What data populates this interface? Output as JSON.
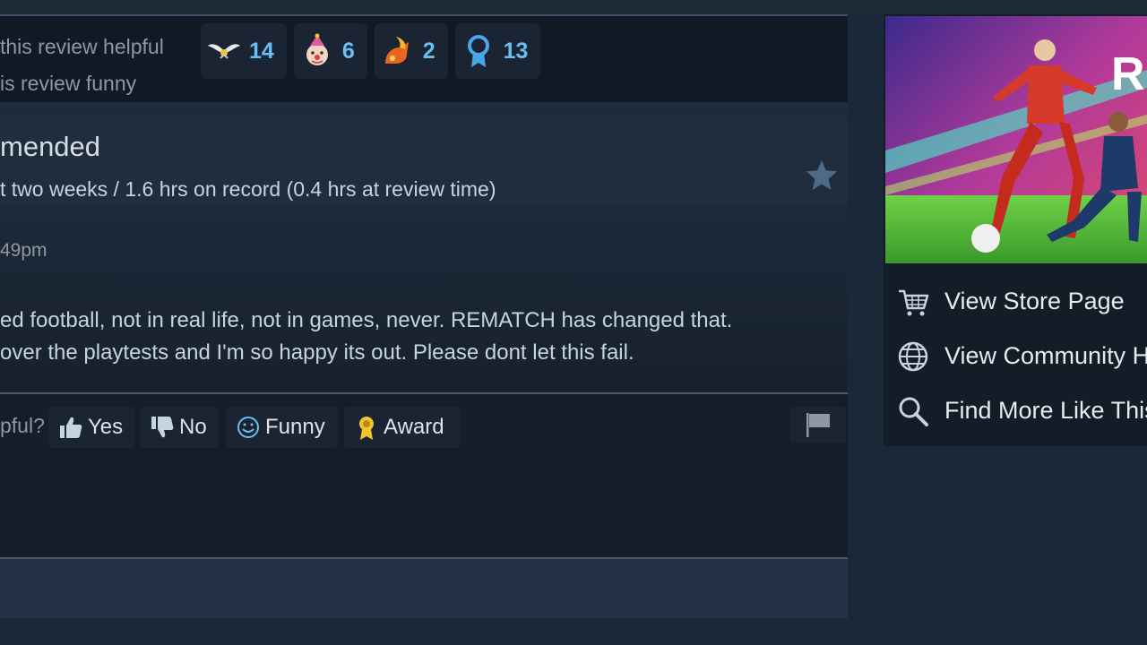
{
  "helpful": {
    "line1": "this review helpful",
    "line2": "is review funny",
    "awards": [
      {
        "icon": "wings-award-icon",
        "count": "14"
      },
      {
        "icon": "clown-award-icon",
        "count": "6"
      },
      {
        "icon": "hot-take-award-icon",
        "count": "2"
      },
      {
        "icon": "ribbon-award-icon",
        "count": "13"
      }
    ]
  },
  "review": {
    "recommendation": "mended",
    "hours": "t two weeks / 1.6 hrs on record (0.4 hrs at review time)",
    "posted": "49pm",
    "body_line1": "ed football, not in real life, not in games, never. REMATCH has changed that.",
    "body_line2": "over the playtests and I'm so happy its out. Please dont let this fail."
  },
  "vote": {
    "question": "pful?",
    "yes": "Yes",
    "no": "No",
    "funny": "Funny",
    "award": "Award"
  },
  "sidebar": {
    "links": [
      {
        "icon": "cart-icon",
        "label": "View Store Page"
      },
      {
        "icon": "globe-icon",
        "label": "View Community Hub"
      },
      {
        "icon": "search-icon",
        "label": "Find More Like This"
      }
    ]
  },
  "colors": {
    "background": "#1b2838",
    "accent": "#66c0f4",
    "award_gold": "#f2c230"
  }
}
